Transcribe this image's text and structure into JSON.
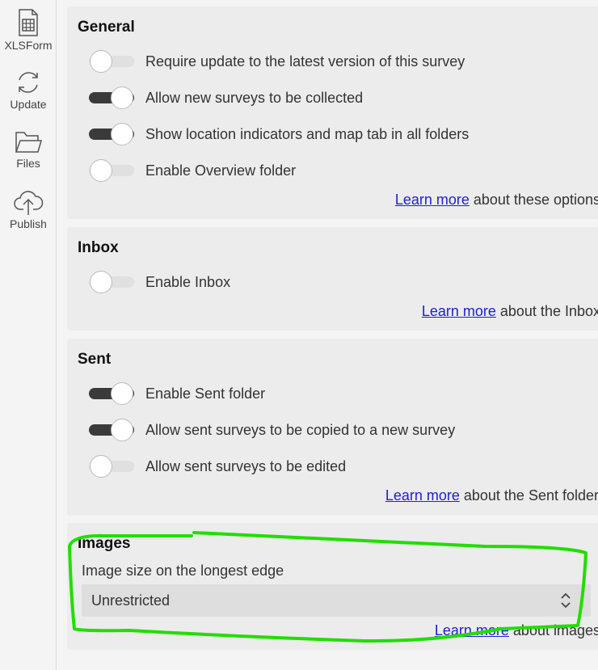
{
  "sidebar": {
    "items": [
      {
        "label": "XLSForm",
        "icon": "spreadsheet-icon"
      },
      {
        "label": "Update",
        "icon": "refresh-icon"
      },
      {
        "label": "Files",
        "icon": "folder-icon"
      },
      {
        "label": "Publish",
        "icon": "cloud-upload-icon"
      }
    ]
  },
  "general": {
    "title": "General",
    "options": [
      {
        "label": "Require update to the latest version of this survey",
        "on": false
      },
      {
        "label": "Allow new surveys to be collected",
        "on": true
      },
      {
        "label": "Show location indicators and map tab in all folders",
        "on": true
      },
      {
        "label": "Enable Overview folder",
        "on": false
      }
    ],
    "learn_link": "Learn more",
    "learn_text": " about these options"
  },
  "inbox": {
    "title": "Inbox",
    "options": [
      {
        "label": "Enable Inbox",
        "on": false
      }
    ],
    "learn_link": "Learn more",
    "learn_text": " about the Inbox"
  },
  "sent": {
    "title": "Sent",
    "options": [
      {
        "label": "Enable Sent folder",
        "on": true
      },
      {
        "label": "Allow sent surveys to be copied to a new survey",
        "on": true
      },
      {
        "label": "Allow sent surveys to be edited",
        "on": false
      }
    ],
    "learn_link": "Learn more",
    "learn_text": " about the Sent folder"
  },
  "images": {
    "title": "Images",
    "field_label": "Image size on the longest edge",
    "select_value": "Unrestricted",
    "learn_link": "Learn more",
    "learn_text": " about images"
  },
  "annotation_color": "#22dd00"
}
